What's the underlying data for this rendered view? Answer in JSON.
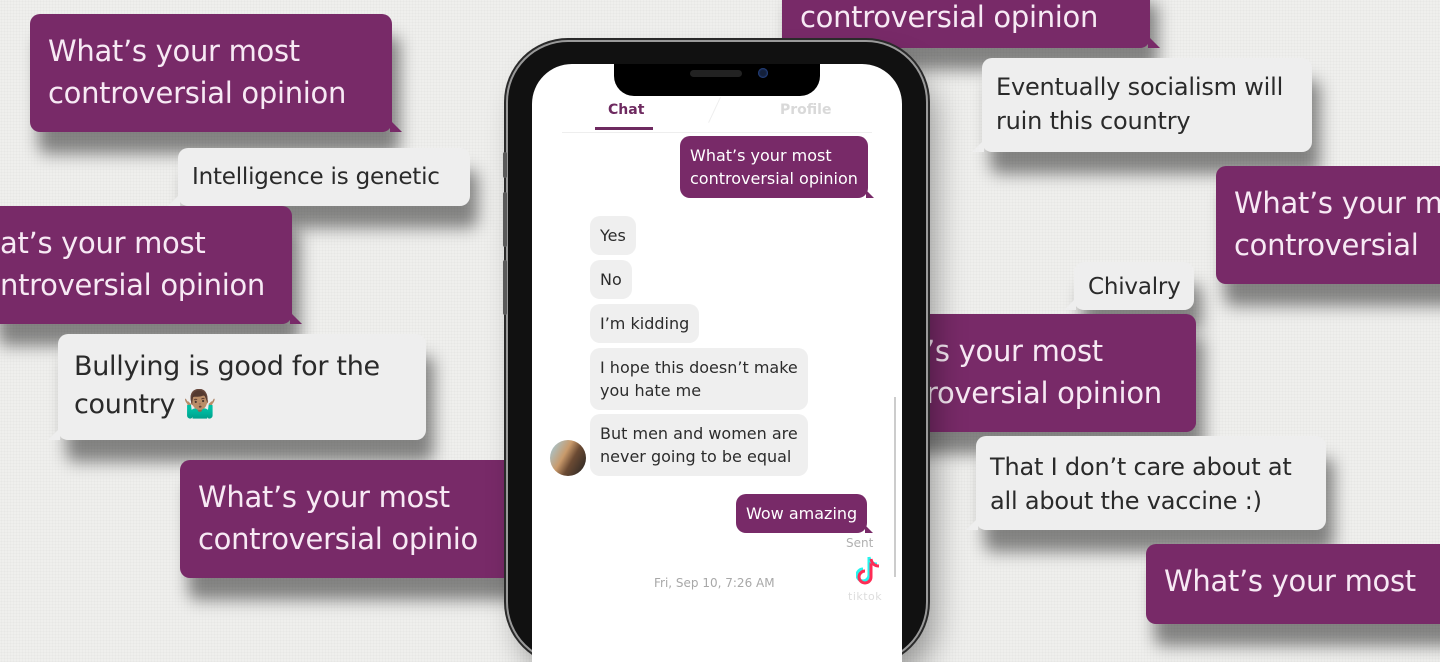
{
  "background_bubbles": [
    {
      "type": "sent",
      "lines": [
        "What’s your most",
        "controversial opinion"
      ]
    },
    {
      "type": "received",
      "lines": [
        "Intelligence is genetic"
      ]
    },
    {
      "type": "sent",
      "lines": [
        "at’s your most",
        "ntroversial opinion"
      ]
    },
    {
      "type": "received",
      "lines": [
        "Bullying is good for the",
        "country 🤷🏽‍♂️"
      ]
    },
    {
      "type": "sent",
      "lines": [
        "What’s your most",
        "controversial opinio"
      ]
    },
    {
      "type": "sent",
      "lines": [
        "controversial opinion"
      ]
    },
    {
      "type": "received",
      "lines": [
        "Eventually socialism will",
        "ruin this country"
      ]
    },
    {
      "type": "sent",
      "lines": [
        "What’s your m",
        "controversial"
      ]
    },
    {
      "type": "received",
      "lines": [
        "Chivalry"
      ]
    },
    {
      "type": "sent",
      "lines": [
        "’s your most",
        "roversial opinion"
      ]
    },
    {
      "type": "received",
      "lines": [
        "That I don’t care about at",
        "all about the vaccine :)"
      ]
    },
    {
      "type": "sent",
      "lines": [
        "What’s your most"
      ]
    }
  ],
  "phone": {
    "tabs": [
      {
        "label": "Chat",
        "active": true
      },
      {
        "label": "Profile",
        "active": false
      }
    ],
    "messages": [
      {
        "direction": "out",
        "lines": [
          "What’s your most",
          "controversial opinion"
        ]
      },
      {
        "direction": "in",
        "lines": [
          "Yes"
        ]
      },
      {
        "direction": "in",
        "lines": [
          "No"
        ]
      },
      {
        "direction": "in",
        "lines": [
          "I’m kidding"
        ]
      },
      {
        "direction": "in",
        "lines": [
          "I hope this doesn’t make",
          "you hate me"
        ]
      },
      {
        "direction": "in",
        "lines": [
          "But men and women are",
          "never going to be equal"
        ]
      },
      {
        "direction": "out",
        "lines": [
          "Wow amazing"
        ]
      }
    ],
    "sent_status": "Sent",
    "date_separator": "Fri, Sep 10, 7:26 AM",
    "watermark": "tiktok",
    "watermark_icon": "tiktok-logo-icon"
  },
  "colors": {
    "accent_purple": "#782a68",
    "received_gray": "#eeeeee",
    "background": "#efefed"
  }
}
